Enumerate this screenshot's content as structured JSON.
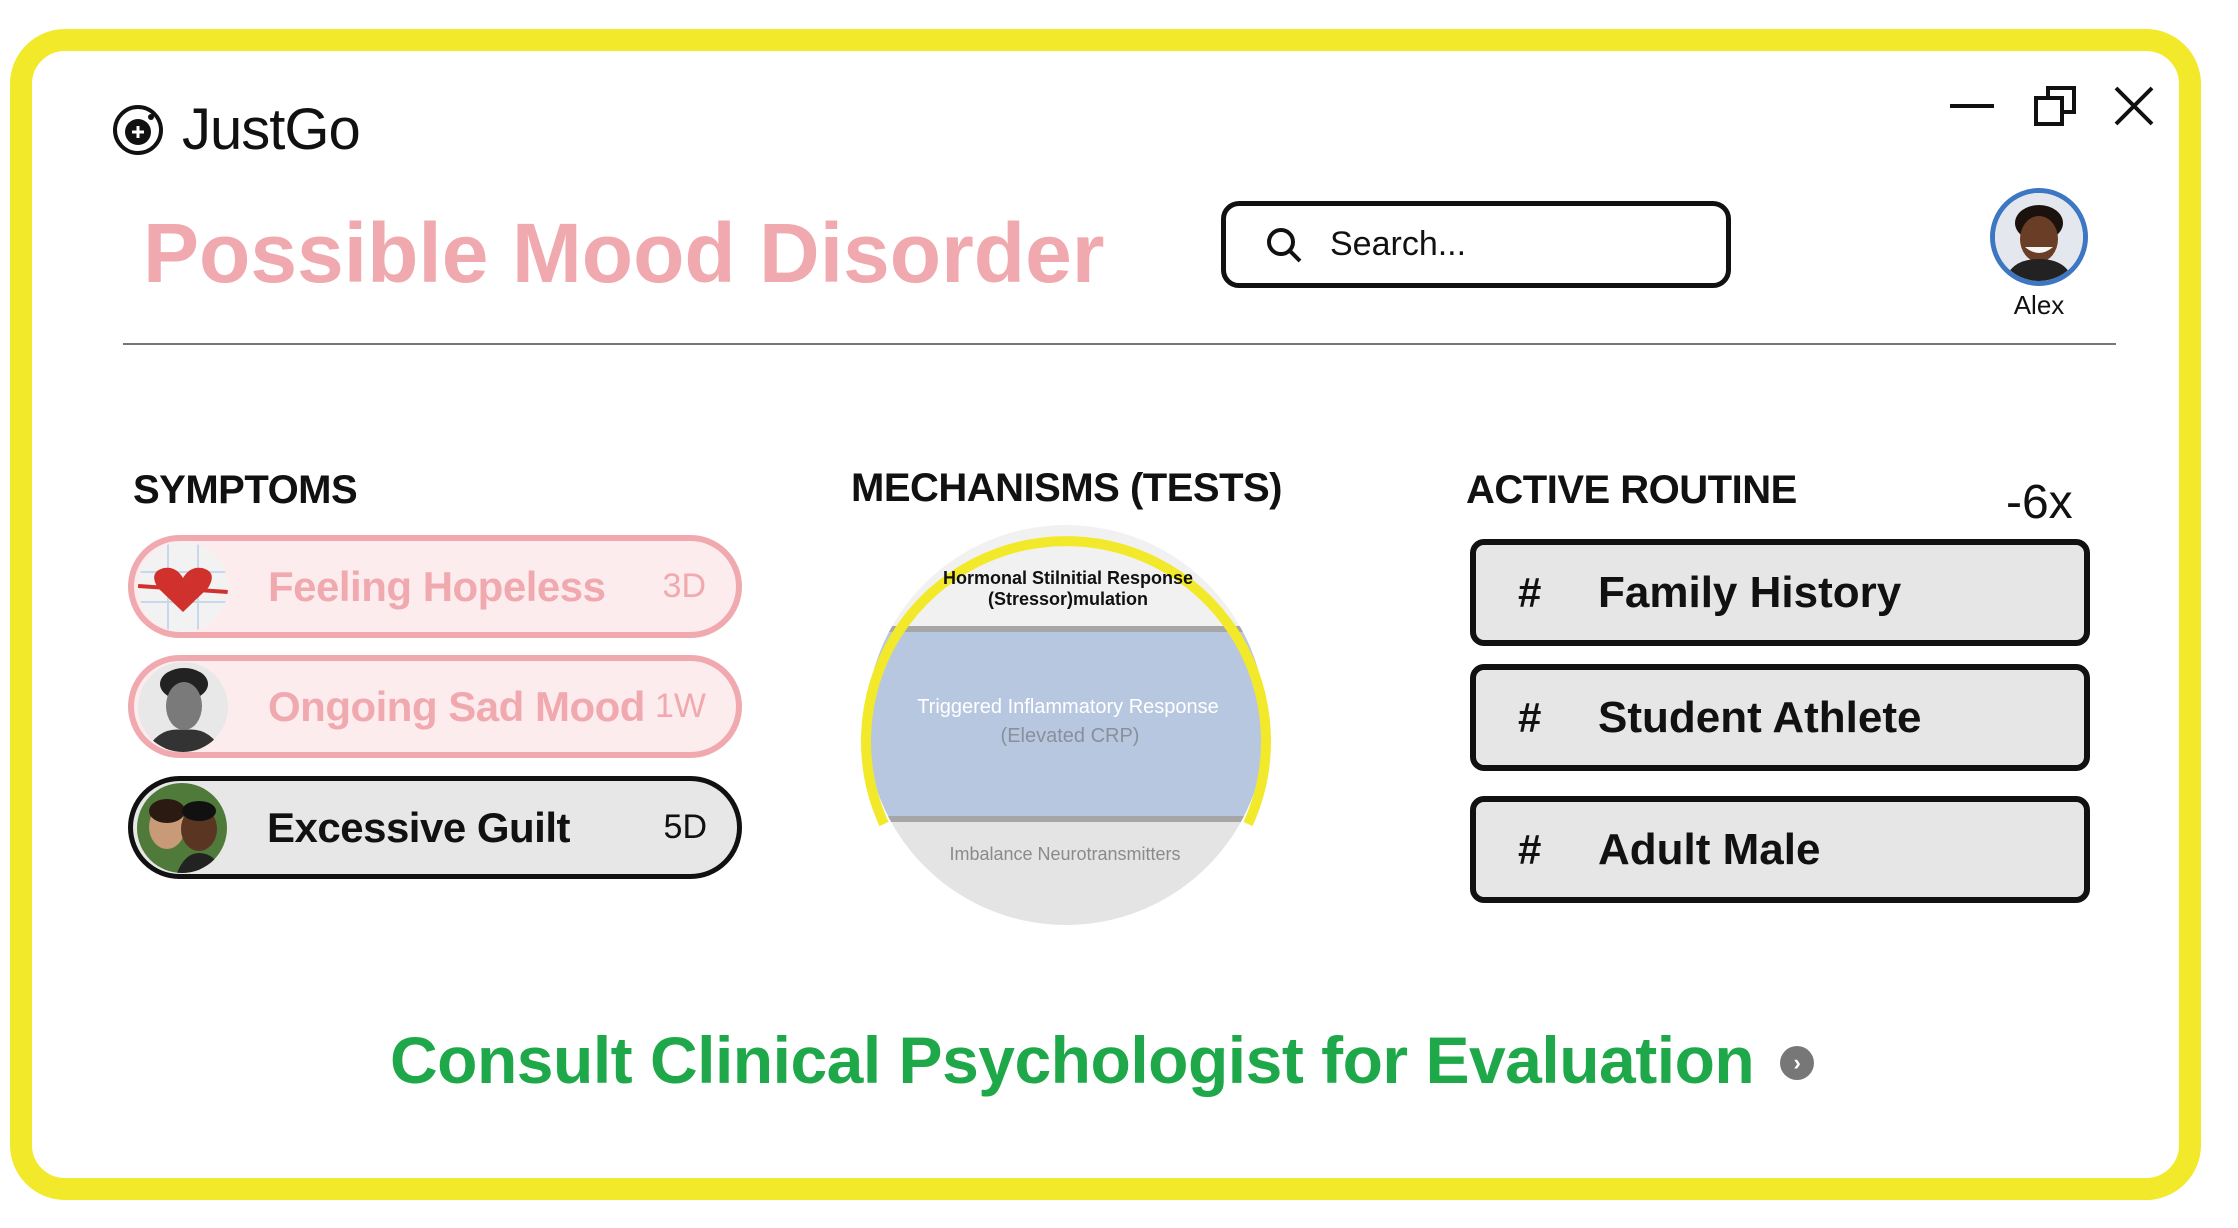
{
  "app": {
    "name": "JustGo"
  },
  "window_controls": {
    "minimize_icon": "minimize-icon",
    "restore_icon": "restore-icon",
    "close_icon": "close-icon"
  },
  "header": {
    "title": "Possible Mood Disorder",
    "search": {
      "placeholder": "Search..."
    },
    "user": {
      "name": "Alex"
    }
  },
  "symptoms": {
    "heading": "SYMPTOMS",
    "items": [
      {
        "label": "Feeling Hopeless",
        "duration": "3D",
        "state": "faded"
      },
      {
        "label": "Ongoing Sad Mood",
        "duration": "1W",
        "state": "faded"
      },
      {
        "label": "Excessive Guilt",
        "duration": "5D",
        "state": "active"
      }
    ]
  },
  "mechanisms": {
    "heading": "MECHANISMS (TESTS)",
    "layers": [
      {
        "line1": "Hormonal Stilnitial Response",
        "line2": "(Stressor)mulation"
      },
      {
        "line1": "Triggered Inflammatory Response",
        "line2": "(Elevated CRP)"
      },
      {
        "line1": "Imbalance Neurotransmitters",
        "line2": ""
      }
    ]
  },
  "routine": {
    "heading": "ACTIVE ROUTINE",
    "multiplier": "-6x",
    "items": [
      {
        "hash": "#",
        "label": "Family History"
      },
      {
        "hash": "#",
        "label": "Student Athlete"
      },
      {
        "hash": "#",
        "label": "Adult Male"
      }
    ]
  },
  "cta": {
    "label": "Consult Clinical Psychologist for Evaluation",
    "icon": "chevron-right-icon"
  },
  "colors": {
    "frame": "#f2e92a",
    "title": "#f0a9ae",
    "cta": "#1ea84a",
    "avatar_ring": "#3d76c2",
    "mid_layer": "#b8c7e0"
  }
}
